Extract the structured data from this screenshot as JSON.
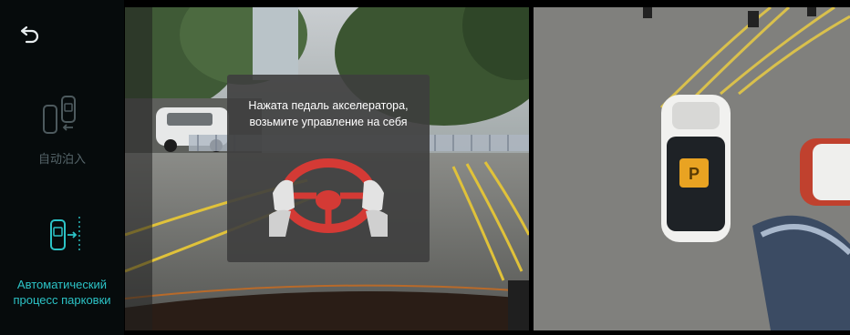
{
  "sidebar": {
    "back_icon": "back-arrow-icon",
    "modes": [
      {
        "label": "自动泊入",
        "icon": "park-in-icon",
        "active": false
      },
      {
        "label_lines": [
          "Автоматический",
          "процесс парковки"
        ],
        "icon": "park-out-icon",
        "active": true
      }
    ]
  },
  "alert": {
    "message_lines": [
      "Нажата педаль акселератора,",
      "возьмите управление на себя"
    ],
    "icon": "steering-wheel-hands-icon"
  },
  "colors": {
    "accent": "#2cc3c6",
    "sidebar_bg": "#060b0c",
    "wheel_red": "#d43a35",
    "lane_yellow": "#e0c23a"
  },
  "birdseye": {
    "car_badge": "parking-p-icon"
  }
}
